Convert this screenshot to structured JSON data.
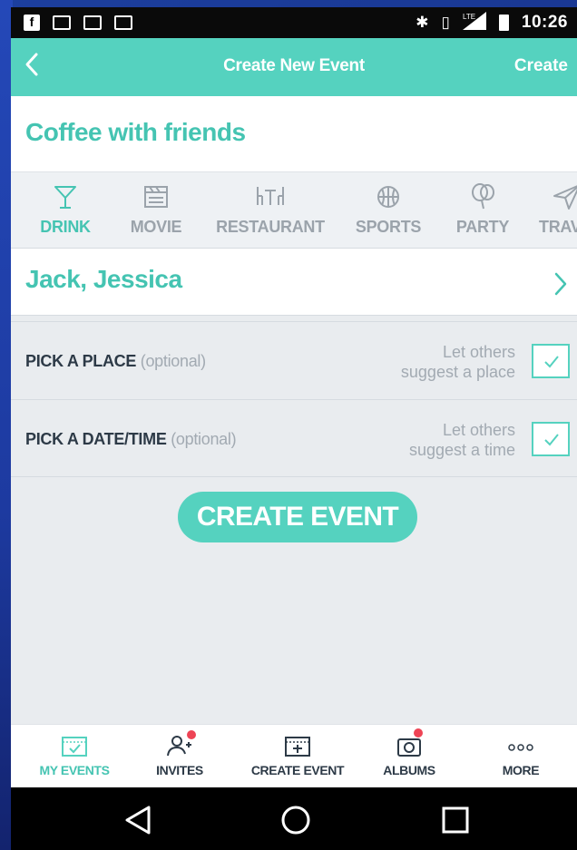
{
  "status_bar": {
    "time": "10:26",
    "network": "LTE",
    "icons": [
      "facebook-icon",
      "image-icon",
      "gallery-icon",
      "gmail-icon",
      "bluetooth-icon",
      "vibrate-icon",
      "signal-icon",
      "battery-icon"
    ]
  },
  "app_bar": {
    "title": "Create New Event",
    "action": "Create",
    "back_icon": "chevron-left-icon"
  },
  "event": {
    "title": "Coffee with friends",
    "invitees": "Jack, Jessica"
  },
  "categories": [
    {
      "label": "DRINK",
      "icon": "cocktail-icon",
      "active": true
    },
    {
      "label": "MOVIE",
      "icon": "clapperboard-icon",
      "active": false
    },
    {
      "label": "RESTAURANT",
      "icon": "table-icon",
      "active": false
    },
    {
      "label": "SPORTS",
      "icon": "basketball-icon",
      "active": false
    },
    {
      "label": "PARTY",
      "icon": "balloon-icon",
      "active": false
    },
    {
      "label": "TRAV",
      "icon": "paper-plane-icon",
      "active": false
    }
  ],
  "options": {
    "place": {
      "label": "PICK A PLACE",
      "optional": "(optional)",
      "suggest_line1": "Let others",
      "suggest_line2": "suggest a place",
      "checked": true
    },
    "datetime": {
      "label": "PICK A DATE/TIME",
      "optional": "(optional)",
      "suggest_line1": "Let others",
      "suggest_line2": "suggest a time",
      "checked": true
    }
  },
  "create_button": "CREATE EVENT",
  "bottom_nav": [
    {
      "label": "MY EVENTS",
      "icon": "calendar-check-icon",
      "active": true,
      "badge": false
    },
    {
      "label": "INVITES",
      "icon": "add-person-icon",
      "active": false,
      "badge": true
    },
    {
      "label": "CREATE EVENT",
      "icon": "calendar-plus-icon",
      "active": false,
      "badge": false
    },
    {
      "label": "ALBUMS",
      "icon": "camera-icon",
      "active": false,
      "badge": true
    },
    {
      "label": "MORE",
      "icon": "more-dots-icon",
      "active": false,
      "badge": false
    }
  ],
  "colors": {
    "accent": "#55d2bf",
    "accent_text": "#45c4b2",
    "muted": "#9ba3ab",
    "dark_text": "#2d3a47",
    "badge": "#ee4455",
    "background": "#e9ecef"
  }
}
